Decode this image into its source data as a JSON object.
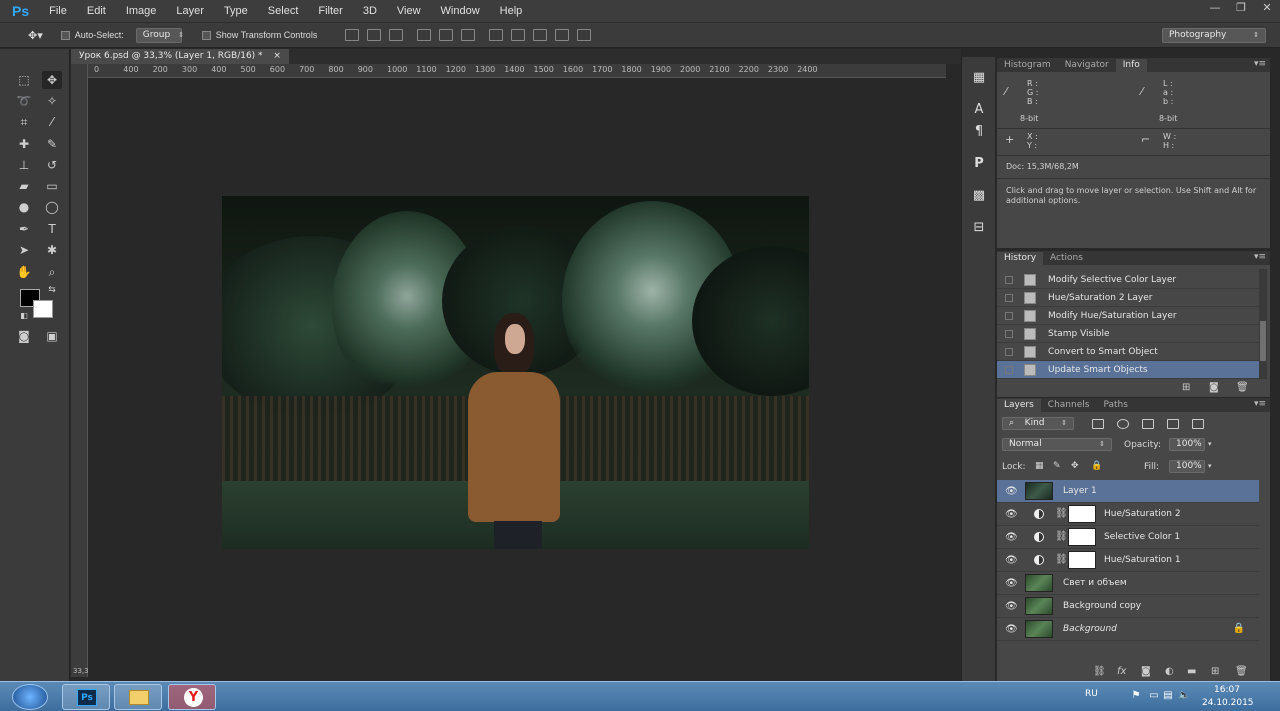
{
  "app": {
    "logo": "Ps",
    "menu": [
      "File",
      "Edit",
      "Image",
      "Layer",
      "Type",
      "Select",
      "Filter",
      "3D",
      "View",
      "Window",
      "Help"
    ],
    "window_controls": {
      "minimize": "—",
      "restore": "❐",
      "close": "✕"
    }
  },
  "options_bar": {
    "auto_select_label": "Auto-Select:",
    "auto_select_value": "Group",
    "show_transform_label": "Show Transform Controls",
    "workspace": "Photography"
  },
  "document": {
    "tab_title": "Урок 6.psd @ 33,3% (Layer 1, RGB/16) *",
    "tab_close": "×",
    "zoom_corner": "33,3",
    "ruler_marks": [
      "0",
      "400",
      "200",
      "300",
      "400",
      "500",
      "600",
      "700",
      "800",
      "900",
      "1000",
      "1100",
      "1200",
      "1300",
      "1400",
      "1500",
      "1600",
      "1700",
      "1800",
      "1900",
      "2000",
      "2100",
      "2200",
      "2300",
      "2400"
    ]
  },
  "info_panel": {
    "tabs": [
      "Histogram",
      "Navigator",
      "Info"
    ],
    "active_tab": "Info",
    "rgb_labels": [
      "R :",
      "G :",
      "B :"
    ],
    "lab_labels": [
      "L :",
      "a :",
      "b :"
    ],
    "bit_left": "8-bit",
    "bit_right": "8-bit",
    "xy_labels": [
      "X :",
      "Y :"
    ],
    "wh_labels": [
      "W :",
      "H :"
    ],
    "doc_size": "Doc: 15,3M/68,2M",
    "hint": "Click and drag to move layer or selection.  Use Shift and Alt for additional options."
  },
  "history_panel": {
    "tabs": [
      "History",
      "Actions"
    ],
    "items": [
      "Modify Selective Color Layer",
      "Hue/Saturation 2 Layer",
      "Modify Hue/Saturation Layer",
      "Stamp Visible",
      "Convert to Smart Object",
      "Update Smart Objects"
    ],
    "selected_index": 5
  },
  "layers_panel": {
    "tabs": [
      "Layers",
      "Channels",
      "Paths"
    ],
    "filter_kind": "Kind",
    "blend_mode": "Normal",
    "opacity_label": "Opacity:",
    "opacity_value": "100%",
    "lock_label": "Lock:",
    "fill_label": "Fill:",
    "fill_value": "100%",
    "layers": [
      "Layer 1",
      "Hue/Saturation 2",
      "Selective Color 1",
      "Hue/Saturation 1",
      "Свет и объем",
      "Background copy",
      "Background"
    ],
    "selected_index": 0
  },
  "taskbar": {
    "language": "RU",
    "time": "16:07",
    "date": "24.10.2015",
    "ps_label": "Ps",
    "yandex_label": "Y"
  }
}
